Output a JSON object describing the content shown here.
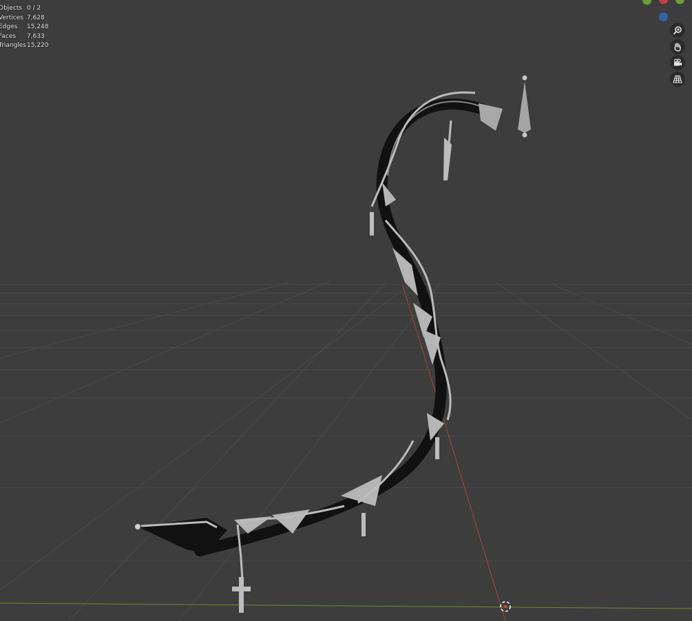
{
  "viewport": {
    "background": "#3d3d3d",
    "grid_color": "#4a4a4a",
    "x_axis_color": "#b0413e",
    "y_axis_color": "#6a8e2c"
  },
  "stats": [
    {
      "label": "Objects",
      "value": "0 / 2"
    },
    {
      "label": "Vertices",
      "value": "7,628"
    },
    {
      "label": "Edges",
      "value": "15,248"
    },
    {
      "label": "Faces",
      "value": "7,633"
    },
    {
      "label": "Triangles",
      "value": "15,220"
    }
  ],
  "gizmo": {
    "axes": [
      {
        "name": "y-axis-ball",
        "color": "#6a9d34"
      },
      {
        "name": "x-axis-ball",
        "color": "#c23d46"
      },
      {
        "name": "y-axis-ball-secondary",
        "color": "#6a9d34"
      },
      {
        "name": "z-axis-ball",
        "color": "#2e63a6"
      }
    ]
  },
  "nav_tools": [
    {
      "name": "zoom-icon",
      "icon": "magnifier"
    },
    {
      "name": "pan-hand-icon",
      "icon": "hand"
    },
    {
      "name": "camera-view-icon",
      "icon": "camera"
    },
    {
      "name": "perspective-grid-icon",
      "icon": "grid"
    }
  ],
  "model": {
    "tube_color": "#111111",
    "metal_color": "#b9b9b9"
  }
}
